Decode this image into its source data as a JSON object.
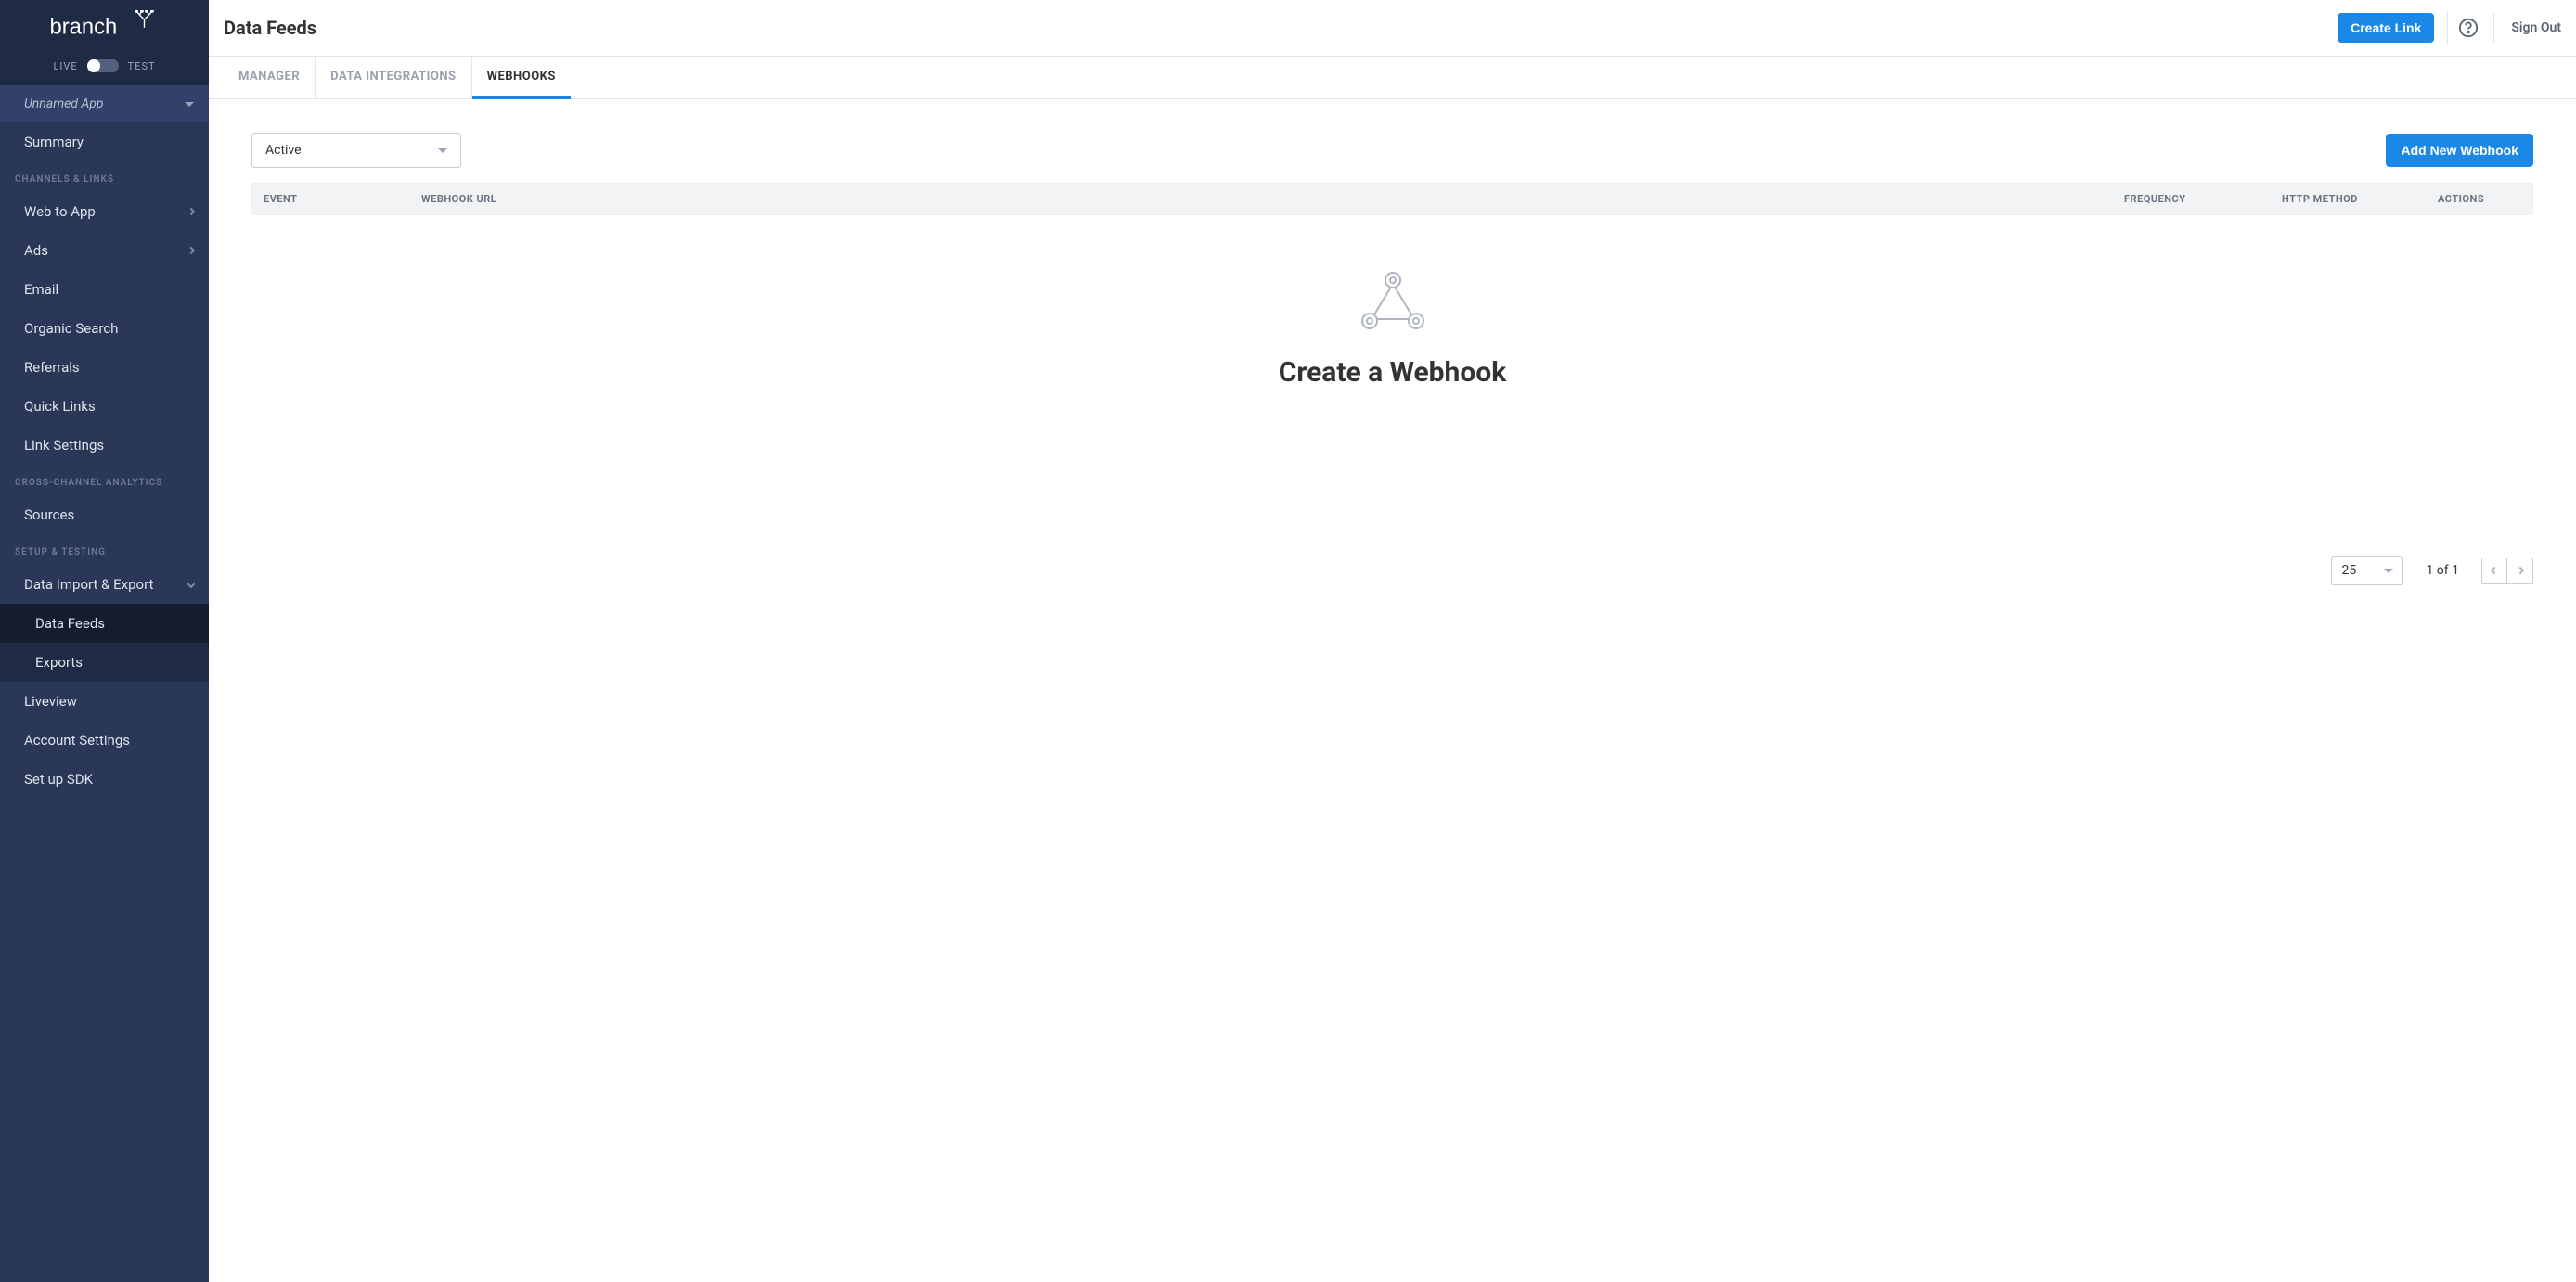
{
  "sidebar": {
    "env": {
      "live": "LIVE",
      "test": "TEST"
    },
    "app_name": "Unnamed App",
    "summary": "Summary",
    "section_channels": "CHANNELS & LINKS",
    "items_channels": [
      {
        "label": "Web to App",
        "chevron": true
      },
      {
        "label": "Ads",
        "chevron": true
      },
      {
        "label": "Email"
      },
      {
        "label": "Organic Search"
      },
      {
        "label": "Referrals"
      },
      {
        "label": "Quick Links"
      },
      {
        "label": "Link Settings"
      }
    ],
    "section_analytics": "CROSS-CHANNEL ANALYTICS",
    "sources": "Sources",
    "section_setup": "SETUP & TESTING",
    "data_import_export": "Data Import & Export",
    "data_feeds": "Data Feeds",
    "exports": "Exports",
    "liveview": "Liveview",
    "account_settings": "Account Settings",
    "setup_sdk": "Set up SDK"
  },
  "header": {
    "title": "Data Feeds",
    "create_link": "Create Link",
    "sign_out": "Sign Out"
  },
  "tabs": {
    "manager": "MANAGER",
    "data_integrations": "DATA INTEGRATIONS",
    "webhooks": "WEBHOOKS"
  },
  "filter": {
    "selected": "Active"
  },
  "add_webhook": "Add New Webhook",
  "table": {
    "event": "EVENT",
    "url": "WEBHOOK URL",
    "frequency": "FREQUENCY",
    "method": "HTTP METHOD",
    "actions": "ACTIONS"
  },
  "empty": {
    "title": "Create a Webhook"
  },
  "pager": {
    "page_size": "25",
    "info": "1 of 1"
  }
}
